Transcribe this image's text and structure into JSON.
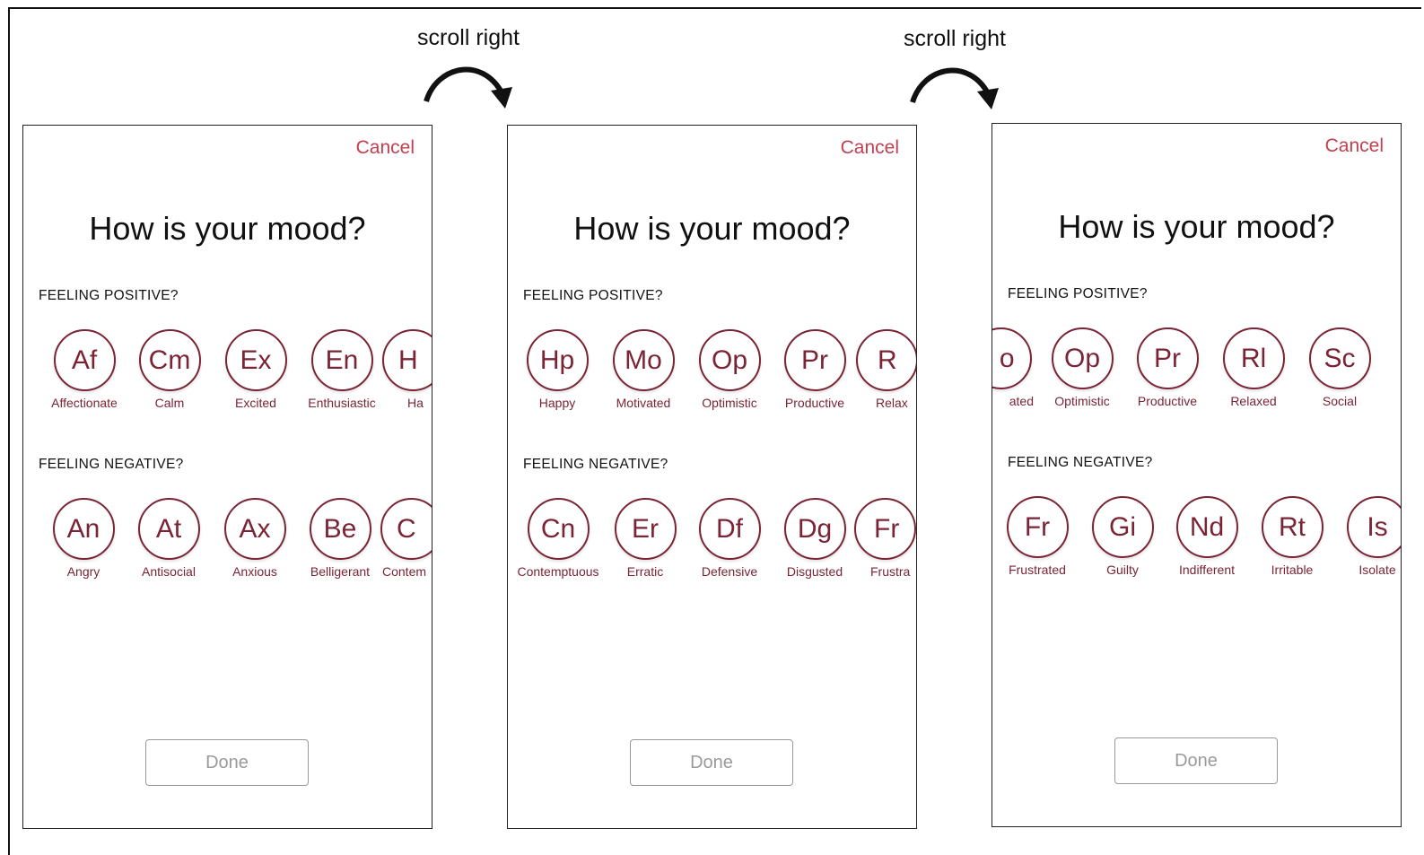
{
  "annotations": {
    "scroll_hint_1": "scroll right",
    "scroll_hint_2": "scroll right"
  },
  "screens": [
    {
      "cancel_label": "Cancel",
      "title": "How is your mood?",
      "positive_label": "FEELING POSITIVE?",
      "negative_label": "FEELING NEGATIVE?",
      "positive": [
        {
          "abbr": "Af",
          "name": "Affectionate"
        },
        {
          "abbr": "Cm",
          "name": "Calm"
        },
        {
          "abbr": "Ex",
          "name": "Excited"
        },
        {
          "abbr": "En",
          "name": "Enthusiastic"
        },
        {
          "abbr": "H",
          "name": "Ha"
        }
      ],
      "negative": [
        {
          "abbr": "An",
          "name": "Angry"
        },
        {
          "abbr": "At",
          "name": "Antisocial"
        },
        {
          "abbr": "Ax",
          "name": "Anxious"
        },
        {
          "abbr": "Be",
          "name": "Belligerant"
        },
        {
          "abbr": "C",
          "name": "Contem"
        }
      ],
      "done_label": "Done"
    },
    {
      "cancel_label": "Cancel",
      "title": "How is your mood?",
      "positive_label": "FEELING POSITIVE?",
      "negative_label": "FEELING NEGATIVE?",
      "positive": [
        {
          "abbr": "Hp",
          "name": "Happy"
        },
        {
          "abbr": "Mo",
          "name": "Motivated"
        },
        {
          "abbr": "Op",
          "name": "Optimistic"
        },
        {
          "abbr": "Pr",
          "name": "Productive"
        },
        {
          "abbr": "R",
          "name": "Relax"
        }
      ],
      "negative": [
        {
          "abbr": "Cn",
          "name": "Contemptuous"
        },
        {
          "abbr": "Er",
          "name": "Erratic"
        },
        {
          "abbr": "Df",
          "name": "Defensive"
        },
        {
          "abbr": "Dg",
          "name": "Disgusted"
        },
        {
          "abbr": "Fr",
          "name": "Frustra"
        }
      ],
      "done_label": "Done"
    },
    {
      "cancel_label": "Cancel",
      "title": "How is your mood?",
      "positive_label": "FEELING POSITIVE?",
      "negative_label": "FEELING NEGATIVE?",
      "positive": [
        {
          "abbr": "o",
          "name": "ated"
        },
        {
          "abbr": "Op",
          "name": "Optimistic"
        },
        {
          "abbr": "Pr",
          "name": "Productive"
        },
        {
          "abbr": "Rl",
          "name": "Relaxed"
        },
        {
          "abbr": "Sc",
          "name": "Social"
        }
      ],
      "negative": [
        {
          "abbr": "Fr",
          "name": "Frustrated"
        },
        {
          "abbr": "Gi",
          "name": "Guilty"
        },
        {
          "abbr": "Nd",
          "name": "Indifferent"
        },
        {
          "abbr": "Rt",
          "name": "Irritable"
        },
        {
          "abbr": "Is",
          "name": "Isolate"
        }
      ],
      "done_label": "Done"
    }
  ],
  "colors": {
    "accent": "#7a2435",
    "cancel": "#c1404f",
    "done_text": "#9a9a9a"
  }
}
